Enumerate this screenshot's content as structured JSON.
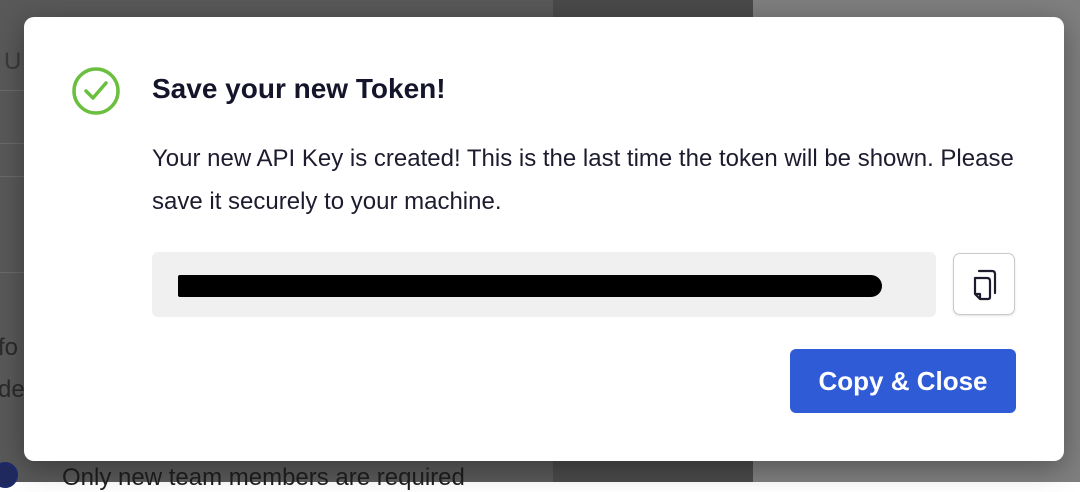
{
  "background": {
    "partial_text_1": "U",
    "partial_text_2": "fo",
    "partial_text_3": "de",
    "partial_text_4": "Only new team members are required"
  },
  "dialog": {
    "status_icon": "check-circle-icon",
    "accent_color": "#6abf3f",
    "title": "Save your new Token!",
    "message": "Your new API Key is created! This is the last time the token will be shown. Please save it securely to your machine.",
    "token_value_redacted": true,
    "copy_icon": "copy-icon",
    "primary_button_label": "Copy & Close",
    "primary_button_color": "#2f5bd7"
  }
}
